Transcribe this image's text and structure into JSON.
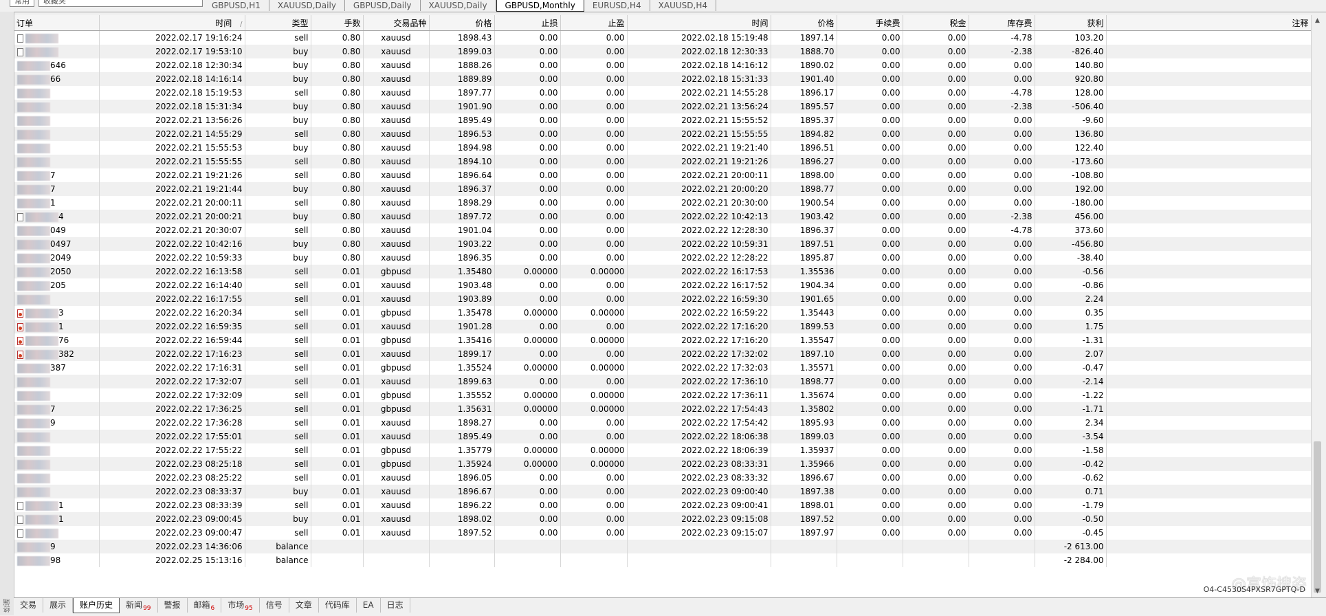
{
  "toolbar": {
    "left_tabs": [
      "常用",
      "收藏夹"
    ],
    "chart_tabs": [
      {
        "label": "GBPUSD,H1",
        "active": false
      },
      {
        "label": "XAUUSD,Daily",
        "active": false
      },
      {
        "label": "GBPUSD,Daily",
        "active": false
      },
      {
        "label": "XAUUSD,Daily",
        "active": false
      },
      {
        "label": "GBPUSD,Monthly",
        "active": true
      },
      {
        "label": "EURUSD,H4",
        "active": false
      },
      {
        "label": "XAUUSD,H4",
        "active": false
      }
    ]
  },
  "side_label": "终端",
  "table": {
    "headers": [
      "订单",
      "时间",
      "类型",
      "手数",
      "交易品种",
      "价格",
      "止损",
      "止盈",
      "时间",
      "价格",
      "手续费",
      "税金",
      "库存费",
      "获利",
      "注释"
    ],
    "sort_indicator": "/",
    "rows": [
      {
        "order": "",
        "icon": "doc",
        "open_time": "2022.02.17 19:16:24",
        "type": "sell",
        "lots": "0.80",
        "symbol": "xauusd",
        "price": "1898.43",
        "sl": "0.00",
        "tp": "0.00",
        "close_time": "2022.02.18 15:19:48",
        "close_price": "1897.14",
        "commission": "0.00",
        "taxes": "0.00",
        "swap": "-4.78",
        "profit": "103.20"
      },
      {
        "order": "",
        "icon": "doc",
        "open_time": "2022.02.17 19:53:10",
        "type": "buy",
        "lots": "0.80",
        "symbol": "xauusd",
        "price": "1899.03",
        "sl": "0.00",
        "tp": "0.00",
        "close_time": "2022.02.18 12:30:33",
        "close_price": "1888.70",
        "commission": "0.00",
        "taxes": "0.00",
        "swap": "-2.38",
        "profit": "-826.40"
      },
      {
        "order": "646",
        "icon": "none",
        "open_time": "2022.02.18 12:30:34",
        "type": "buy",
        "lots": "0.80",
        "symbol": "xauusd",
        "price": "1888.26",
        "sl": "0.00",
        "tp": "0.00",
        "close_time": "2022.02.18 14:16:12",
        "close_price": "1890.02",
        "commission": "0.00",
        "taxes": "0.00",
        "swap": "0.00",
        "profit": "140.80"
      },
      {
        "order": "66",
        "icon": "none",
        "open_time": "2022.02.18 14:16:14",
        "type": "buy",
        "lots": "0.80",
        "symbol": "xauusd",
        "price": "1889.89",
        "sl": "0.00",
        "tp": "0.00",
        "close_time": "2022.02.18 15:31:33",
        "close_price": "1901.40",
        "commission": "0.00",
        "taxes": "0.00",
        "swap": "0.00",
        "profit": "920.80"
      },
      {
        "order": "",
        "icon": "none",
        "open_time": "2022.02.18 15:19:53",
        "type": "sell",
        "lots": "0.80",
        "symbol": "xauusd",
        "price": "1897.77",
        "sl": "0.00",
        "tp": "0.00",
        "close_time": "2022.02.21 14:55:28",
        "close_price": "1896.17",
        "commission": "0.00",
        "taxes": "0.00",
        "swap": "-4.78",
        "profit": "128.00"
      },
      {
        "order": "",
        "icon": "none",
        "open_time": "2022.02.18 15:31:34",
        "type": "buy",
        "lots": "0.80",
        "symbol": "xauusd",
        "price": "1901.90",
        "sl": "0.00",
        "tp": "0.00",
        "close_time": "2022.02.21 13:56:24",
        "close_price": "1895.57",
        "commission": "0.00",
        "taxes": "0.00",
        "swap": "-2.38",
        "profit": "-506.40"
      },
      {
        "order": "",
        "icon": "none",
        "open_time": "2022.02.21 13:56:26",
        "type": "buy",
        "lots": "0.80",
        "symbol": "xauusd",
        "price": "1895.49",
        "sl": "0.00",
        "tp": "0.00",
        "close_time": "2022.02.21 15:55:52",
        "close_price": "1895.37",
        "commission": "0.00",
        "taxes": "0.00",
        "swap": "0.00",
        "profit": "-9.60"
      },
      {
        "order": "",
        "icon": "none",
        "open_time": "2022.02.21 14:55:29",
        "type": "sell",
        "lots": "0.80",
        "symbol": "xauusd",
        "price": "1896.53",
        "sl": "0.00",
        "tp": "0.00",
        "close_time": "2022.02.21 15:55:55",
        "close_price": "1894.82",
        "commission": "0.00",
        "taxes": "0.00",
        "swap": "0.00",
        "profit": "136.80"
      },
      {
        "order": "",
        "icon": "none",
        "open_time": "2022.02.21 15:55:53",
        "type": "buy",
        "lots": "0.80",
        "symbol": "xauusd",
        "price": "1894.98",
        "sl": "0.00",
        "tp": "0.00",
        "close_time": "2022.02.21 19:21:40",
        "close_price": "1896.51",
        "commission": "0.00",
        "taxes": "0.00",
        "swap": "0.00",
        "profit": "122.40"
      },
      {
        "order": "",
        "icon": "none",
        "open_time": "2022.02.21 15:55:55",
        "type": "sell",
        "lots": "0.80",
        "symbol": "xauusd",
        "price": "1894.10",
        "sl": "0.00",
        "tp": "0.00",
        "close_time": "2022.02.21 19:21:26",
        "close_price": "1896.27",
        "commission": "0.00",
        "taxes": "0.00",
        "swap": "0.00",
        "profit": "-173.60"
      },
      {
        "order": "7",
        "icon": "none",
        "open_time": "2022.02.21 19:21:26",
        "type": "sell",
        "lots": "0.80",
        "symbol": "xauusd",
        "price": "1896.64",
        "sl": "0.00",
        "tp": "0.00",
        "close_time": "2022.02.21 20:00:11",
        "close_price": "1898.00",
        "commission": "0.00",
        "taxes": "0.00",
        "swap": "0.00",
        "profit": "-108.80"
      },
      {
        "order": "7",
        "icon": "none",
        "open_time": "2022.02.21 19:21:44",
        "type": "buy",
        "lots": "0.80",
        "symbol": "xauusd",
        "price": "1896.37",
        "sl": "0.00",
        "tp": "0.00",
        "close_time": "2022.02.21 20:00:20",
        "close_price": "1898.77",
        "commission": "0.00",
        "taxes": "0.00",
        "swap": "0.00",
        "profit": "192.00"
      },
      {
        "order": "1",
        "icon": "none",
        "open_time": "2022.02.21 20:00:11",
        "type": "sell",
        "lots": "0.80",
        "symbol": "xauusd",
        "price": "1898.29",
        "sl": "0.00",
        "tp": "0.00",
        "close_time": "2022.02.21 20:30:00",
        "close_price": "1900.54",
        "commission": "0.00",
        "taxes": "0.00",
        "swap": "0.00",
        "profit": "-180.00"
      },
      {
        "order": "4",
        "icon": "doc",
        "open_time": "2022.02.21 20:00:21",
        "type": "buy",
        "lots": "0.80",
        "symbol": "xauusd",
        "price": "1897.72",
        "sl": "0.00",
        "tp": "0.00",
        "close_time": "2022.02.22 10:42:13",
        "close_price": "1903.42",
        "commission": "0.00",
        "taxes": "0.00",
        "swap": "-2.38",
        "profit": "456.00"
      },
      {
        "order": "049",
        "icon": "none",
        "open_time": "2022.02.21 20:30:07",
        "type": "sell",
        "lots": "0.80",
        "symbol": "xauusd",
        "price": "1901.04",
        "sl": "0.00",
        "tp": "0.00",
        "close_time": "2022.02.22 12:28:30",
        "close_price": "1896.37",
        "commission": "0.00",
        "taxes": "0.00",
        "swap": "-4.78",
        "profit": "373.60"
      },
      {
        "order": "0497",
        "icon": "none",
        "open_time": "2022.02.22 10:42:16",
        "type": "buy",
        "lots": "0.80",
        "symbol": "xauusd",
        "price": "1903.22",
        "sl": "0.00",
        "tp": "0.00",
        "close_time": "2022.02.22 10:59:31",
        "close_price": "1897.51",
        "commission": "0.00",
        "taxes": "0.00",
        "swap": "0.00",
        "profit": "-456.80"
      },
      {
        "order": "2049",
        "icon": "none",
        "open_time": "2022.02.22 10:59:33",
        "type": "buy",
        "lots": "0.80",
        "symbol": "xauusd",
        "price": "1896.35",
        "sl": "0.00",
        "tp": "0.00",
        "close_time": "2022.02.22 12:28:22",
        "close_price": "1895.87",
        "commission": "0.00",
        "taxes": "0.00",
        "swap": "0.00",
        "profit": "-38.40"
      },
      {
        "order": "2050",
        "icon": "none",
        "open_time": "2022.02.22 16:13:58",
        "type": "sell",
        "lots": "0.01",
        "symbol": "gbpusd",
        "price": "1.35480",
        "sl": "0.00000",
        "tp": "0.00000",
        "close_time": "2022.02.22 16:17:53",
        "close_price": "1.35536",
        "commission": "0.00",
        "taxes": "0.00",
        "swap": "0.00",
        "profit": "-0.56"
      },
      {
        "order": "205",
        "icon": "none",
        "open_time": "2022.02.22 16:14:40",
        "type": "sell",
        "lots": "0.01",
        "symbol": "xauusd",
        "price": "1903.48",
        "sl": "0.00",
        "tp": "0.00",
        "close_time": "2022.02.22 16:17:52",
        "close_price": "1904.34",
        "commission": "0.00",
        "taxes": "0.00",
        "swap": "0.00",
        "profit": "-0.86"
      },
      {
        "order": "",
        "icon": "none",
        "open_time": "2022.02.22 16:17:55",
        "type": "sell",
        "lots": "0.01",
        "symbol": "xauusd",
        "price": "1903.89",
        "sl": "0.00",
        "tp": "0.00",
        "close_time": "2022.02.22 16:59:30",
        "close_price": "1901.65",
        "commission": "0.00",
        "taxes": "0.00",
        "swap": "0.00",
        "profit": "2.24"
      },
      {
        "order": "3",
        "icon": "red",
        "open_time": "2022.02.22 16:20:34",
        "type": "sell",
        "lots": "0.01",
        "symbol": "gbpusd",
        "price": "1.35478",
        "sl": "0.00000",
        "tp": "0.00000",
        "close_time": "2022.02.22 16:59:22",
        "close_price": "1.35443",
        "commission": "0.00",
        "taxes": "0.00",
        "swap": "0.00",
        "profit": "0.35"
      },
      {
        "order": "1",
        "icon": "red",
        "open_time": "2022.02.22 16:59:35",
        "type": "sell",
        "lots": "0.01",
        "symbol": "xauusd",
        "price": "1901.28",
        "sl": "0.00",
        "tp": "0.00",
        "close_time": "2022.02.22 17:16:20",
        "close_price": "1899.53",
        "commission": "0.00",
        "taxes": "0.00",
        "swap": "0.00",
        "profit": "1.75"
      },
      {
        "order": "76",
        "icon": "red",
        "open_time": "2022.02.22 16:59:44",
        "type": "sell",
        "lots": "0.01",
        "symbol": "gbpusd",
        "price": "1.35416",
        "sl": "0.00000",
        "tp": "0.00000",
        "close_time": "2022.02.22 17:16:20",
        "close_price": "1.35547",
        "commission": "0.00",
        "taxes": "0.00",
        "swap": "0.00",
        "profit": "-1.31"
      },
      {
        "order": "382",
        "icon": "red",
        "open_time": "2022.02.22 17:16:23",
        "type": "sell",
        "lots": "0.01",
        "symbol": "xauusd",
        "price": "1899.17",
        "sl": "0.00",
        "tp": "0.00",
        "close_time": "2022.02.22 17:32:02",
        "close_price": "1897.10",
        "commission": "0.00",
        "taxes": "0.00",
        "swap": "0.00",
        "profit": "2.07"
      },
      {
        "order": "387",
        "icon": "none",
        "open_time": "2022.02.22 17:16:31",
        "type": "sell",
        "lots": "0.01",
        "symbol": "gbpusd",
        "price": "1.35524",
        "sl": "0.00000",
        "tp": "0.00000",
        "close_time": "2022.02.22 17:32:03",
        "close_price": "1.35571",
        "commission": "0.00",
        "taxes": "0.00",
        "swap": "0.00",
        "profit": "-0.47"
      },
      {
        "order": "",
        "icon": "none",
        "open_time": "2022.02.22 17:32:07",
        "type": "sell",
        "lots": "0.01",
        "symbol": "xauusd",
        "price": "1899.63",
        "sl": "0.00",
        "tp": "0.00",
        "close_time": "2022.02.22 17:36:10",
        "close_price": "1898.77",
        "commission": "0.00",
        "taxes": "0.00",
        "swap": "0.00",
        "profit": "-2.14"
      },
      {
        "order": "",
        "icon": "none",
        "open_time": "2022.02.22 17:32:09",
        "type": "sell",
        "lots": "0.01",
        "symbol": "gbpusd",
        "price": "1.35552",
        "sl": "0.00000",
        "tp": "0.00000",
        "close_time": "2022.02.22 17:36:11",
        "close_price": "1.35674",
        "commission": "0.00",
        "taxes": "0.00",
        "swap": "0.00",
        "profit": "-1.22"
      },
      {
        "order": "7",
        "icon": "none",
        "open_time": "2022.02.22 17:36:25",
        "type": "sell",
        "lots": "0.01",
        "symbol": "gbpusd",
        "price": "1.35631",
        "sl": "0.00000",
        "tp": "0.00000",
        "close_time": "2022.02.22 17:54:43",
        "close_price": "1.35802",
        "commission": "0.00",
        "taxes": "0.00",
        "swap": "0.00",
        "profit": "-1.71"
      },
      {
        "order": "9",
        "icon": "none",
        "open_time": "2022.02.22 17:36:28",
        "type": "sell",
        "lots": "0.01",
        "symbol": "xauusd",
        "price": "1898.27",
        "sl": "0.00",
        "tp": "0.00",
        "close_time": "2022.02.22 17:54:42",
        "close_price": "1895.93",
        "commission": "0.00",
        "taxes": "0.00",
        "swap": "0.00",
        "profit": "2.34"
      },
      {
        "order": "",
        "icon": "none",
        "open_time": "2022.02.22 17:55:01",
        "type": "sell",
        "lots": "0.01",
        "symbol": "xauusd",
        "price": "1895.49",
        "sl": "0.00",
        "tp": "0.00",
        "close_time": "2022.02.22 18:06:38",
        "close_price": "1899.03",
        "commission": "0.00",
        "taxes": "0.00",
        "swap": "0.00",
        "profit": "-3.54"
      },
      {
        "order": "",
        "icon": "none",
        "open_time": "2022.02.22 17:55:22",
        "type": "sell",
        "lots": "0.01",
        "symbol": "gbpusd",
        "price": "1.35779",
        "sl": "0.00000",
        "tp": "0.00000",
        "close_time": "2022.02.22 18:06:39",
        "close_price": "1.35937",
        "commission": "0.00",
        "taxes": "0.00",
        "swap": "0.00",
        "profit": "-1.58"
      },
      {
        "order": "",
        "icon": "none",
        "open_time": "2022.02.23 08:25:18",
        "type": "sell",
        "lots": "0.01",
        "symbol": "gbpusd",
        "price": "1.35924",
        "sl": "0.00000",
        "tp": "0.00000",
        "close_time": "2022.02.23 08:33:31",
        "close_price": "1.35966",
        "commission": "0.00",
        "taxes": "0.00",
        "swap": "0.00",
        "profit": "-0.42"
      },
      {
        "order": "",
        "icon": "none",
        "open_time": "2022.02.23 08:25:22",
        "type": "sell",
        "lots": "0.01",
        "symbol": "xauusd",
        "price": "1896.05",
        "sl": "0.00",
        "tp": "0.00",
        "close_time": "2022.02.23 08:33:32",
        "close_price": "1896.67",
        "commission": "0.00",
        "taxes": "0.00",
        "swap": "0.00",
        "profit": "-0.62"
      },
      {
        "order": "",
        "icon": "none",
        "open_time": "2022.02.23 08:33:37",
        "type": "buy",
        "lots": "0.01",
        "symbol": "xauusd",
        "price": "1896.67",
        "sl": "0.00",
        "tp": "0.00",
        "close_time": "2022.02.23 09:00:40",
        "close_price": "1897.38",
        "commission": "0.00",
        "taxes": "0.00",
        "swap": "0.00",
        "profit": "0.71"
      },
      {
        "order": "1",
        "icon": "doc",
        "open_time": "2022.02.23 08:33:39",
        "type": "sell",
        "lots": "0.01",
        "symbol": "xauusd",
        "price": "1896.22",
        "sl": "0.00",
        "tp": "0.00",
        "close_time": "2022.02.23 09:00:41",
        "close_price": "1898.01",
        "commission": "0.00",
        "taxes": "0.00",
        "swap": "0.00",
        "profit": "-1.79"
      },
      {
        "order": "1",
        "icon": "doc",
        "open_time": "2022.02.23 09:00:45",
        "type": "buy",
        "lots": "0.01",
        "symbol": "xauusd",
        "price": "1898.02",
        "sl": "0.00",
        "tp": "0.00",
        "close_time": "2022.02.23 09:15:08",
        "close_price": "1897.52",
        "commission": "0.00",
        "taxes": "0.00",
        "swap": "0.00",
        "profit": "-0.50"
      },
      {
        "order": "",
        "icon": "doc",
        "open_time": "2022.02.23 09:00:47",
        "type": "sell",
        "lots": "0.01",
        "symbol": "xauusd",
        "price": "1897.52",
        "sl": "0.00",
        "tp": "0.00",
        "close_time": "2022.02.23 09:15:07",
        "close_price": "1897.97",
        "commission": "0.00",
        "taxes": "0.00",
        "swap": "0.00",
        "profit": "-0.45"
      },
      {
        "order": "9",
        "icon": "none",
        "open_time": "2022.02.23 14:36:06",
        "type": "balance",
        "lots": "",
        "symbol": "",
        "price": "",
        "sl": "",
        "tp": "",
        "close_time": "",
        "close_price": "",
        "commission": "",
        "taxes": "",
        "swap": "",
        "profit": "-2 613.00"
      },
      {
        "order": "98",
        "icon": "none",
        "open_time": "2022.02.25 15:13:16",
        "type": "balance",
        "lots": "",
        "symbol": "",
        "price": "",
        "sl": "",
        "tp": "",
        "close_time": "",
        "close_price": "",
        "commission": "",
        "taxes": "",
        "swap": "",
        "profit": "-2 284.00"
      }
    ]
  },
  "bottom_tabs": [
    {
      "label": "交易",
      "badge": ""
    },
    {
      "label": "展示",
      "badge": ""
    },
    {
      "label": "账户历史",
      "badge": "",
      "active": true
    },
    {
      "label": "新闻",
      "badge": "99"
    },
    {
      "label": "警报",
      "badge": ""
    },
    {
      "label": "邮箱",
      "badge": "6"
    },
    {
      "label": "市场",
      "badge": "95"
    },
    {
      "label": "信号",
      "badge": ""
    },
    {
      "label": "文章",
      "badge": ""
    },
    {
      "label": "代码库",
      "badge": ""
    },
    {
      "label": "EA",
      "badge": ""
    },
    {
      "label": "日志",
      "badge": ""
    }
  ],
  "watermark_text": "@富饰搜姿",
  "footer_code": "O4-C4530S4PXSR7GPTQ-D"
}
